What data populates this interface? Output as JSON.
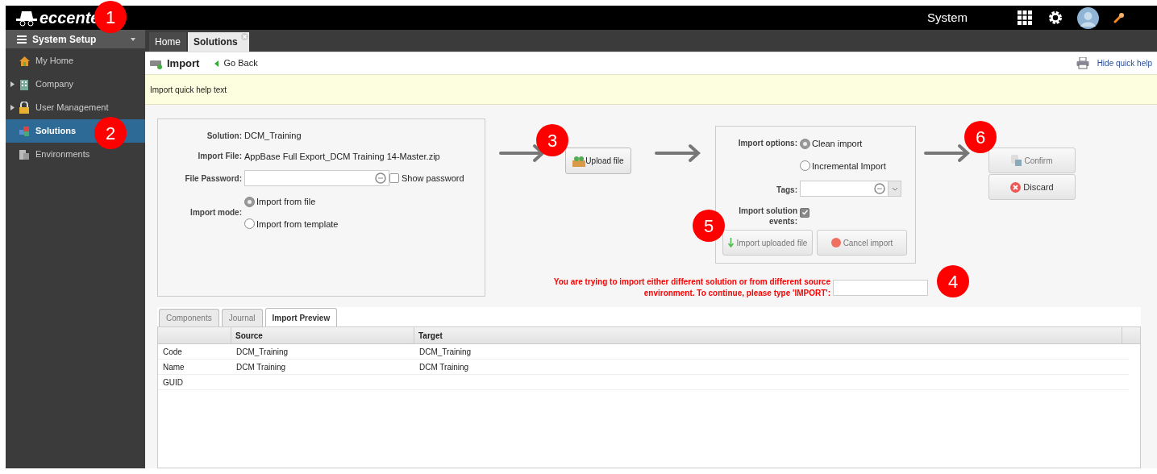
{
  "header": {
    "logo": "eccente",
    "context": "System"
  },
  "sidebar": {
    "title": "System Setup",
    "items": [
      {
        "label": "My Home",
        "expandable": false,
        "selected": false
      },
      {
        "label": "Company",
        "expandable": true,
        "selected": false
      },
      {
        "label": "User Management",
        "expandable": true,
        "selected": false
      },
      {
        "label": "Solutions",
        "expandable": false,
        "selected": true
      },
      {
        "label": "Environments",
        "expandable": false,
        "selected": false
      }
    ]
  },
  "tabs": [
    {
      "label": "Home",
      "selected": false,
      "closable": false
    },
    {
      "label": "Solutions",
      "selected": true,
      "closable": true
    }
  ],
  "toolbar": {
    "title": "Import",
    "back": "Go Back",
    "help_link": "Hide quick help"
  },
  "quick_help": "Import quick help text",
  "form": {
    "solution_label": "Solution:",
    "solution": "DCM_Training",
    "file_label": "Import File:",
    "file": "AppBase Full Export_DCM Training 14-Master.zip",
    "password_label": "File Password:",
    "show_password": {
      "label": "Show password",
      "checked": false
    },
    "mode_label": "Import mode:",
    "modes": [
      {
        "label": "Import from file",
        "selected": true
      },
      {
        "label": "Import from template",
        "selected": false
      }
    ]
  },
  "upload_button": "Upload file",
  "options": {
    "label": "Import options:",
    "choices": [
      {
        "label": "Clean import",
        "selected": true
      },
      {
        "label": "Incremental Import",
        "selected": false
      }
    ],
    "tags_label": "Tags:",
    "events_label": "Import solution events:",
    "events_checked": true,
    "import_button": {
      "label": "Import uploaded file",
      "disabled": true
    },
    "cancel_button": {
      "label": "Cancel import",
      "disabled": true
    }
  },
  "confirm": {
    "label": "Confirm",
    "disabled": true
  },
  "discard": {
    "label": "Discard",
    "disabled": false
  },
  "warning": "You are trying to import either different solution or from different source environment. To continue, please type 'IMPORT':",
  "bottom_tabs": [
    {
      "label": "Components",
      "selected": false
    },
    {
      "label": "Journal",
      "selected": false
    },
    {
      "label": "Import Preview",
      "selected": true
    }
  ],
  "grid": {
    "columns": [
      "",
      "Source",
      "Target"
    ],
    "rows": [
      {
        "cells": [
          "Code",
          "DCM_Training",
          "DCM_Training"
        ]
      },
      {
        "cells": [
          "Name",
          "DCM Training",
          "DCM Training"
        ]
      },
      {
        "cells": [
          "GUID"
        ]
      }
    ]
  },
  "callouts": [
    "1",
    "2",
    "3",
    "4",
    "5",
    "6"
  ]
}
